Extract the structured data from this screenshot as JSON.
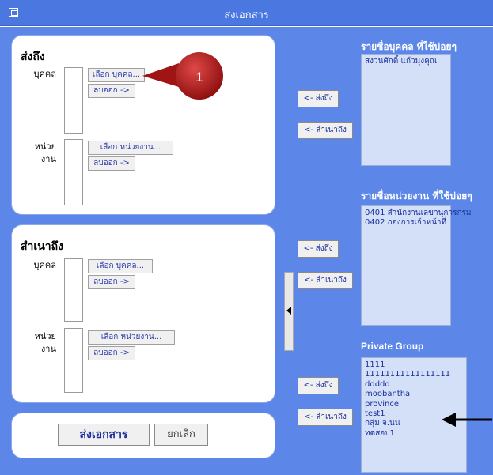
{
  "window": {
    "title": "ส่งเอกสาร"
  },
  "send_to": {
    "heading": "ส่งถึง",
    "person_label": "บุคคล",
    "unit_label_1": "หน่วย",
    "unit_label_2": "งาน",
    "select_person_button": "เลือก บุคคล...",
    "remove_person_button": "ลบออก ->",
    "select_unit_button": "เลือก หน่วยงาน...",
    "remove_unit_button": "ลบออก ->"
  },
  "copy_to": {
    "heading": "สำเนาถึง",
    "person_label": "บุคคล",
    "unit_label_1": "หน่วย",
    "unit_label_2": "งาน",
    "select_person_button": "เลือก บุคคล...",
    "remove_person_button": "ลบออก ->",
    "select_unit_button": "เลือก หน่วยงาน...",
    "remove_unit_button": "ลบออก ->"
  },
  "actions": {
    "send_button": "ส่งเอกสาร",
    "cancel_button": "ยกเลิก"
  },
  "middle": {
    "send_to_button": "<- ส่งถึง",
    "copy_to_button": "<- สำเนาถึง",
    "splitter_icon": "triangle-left-icon"
  },
  "frequent_people": {
    "header": "รายชื่อบุคคล ที่ใช้บ่อยๆ",
    "items": [
      "สงวนศักดิ์ แก้วมุงคุณ"
    ]
  },
  "frequent_units": {
    "header": "รายชื่อหน่วยงาน ที่ใช้บ่อยๆ",
    "items": [
      "0401 สำนักงานเลขานุการกรม",
      "0402 กองการเจ้าหน้าที่"
    ]
  },
  "private_group": {
    "header": "Private Group",
    "items": [
      "1111",
      "11111111111111111",
      "ddddd",
      "moobanthai",
      "province",
      "test1",
      "กลุ่ม จ.นน",
      "ทดสอบ1"
    ]
  },
  "annotation": {
    "callout_number": "1",
    "callout_color": "#b01818",
    "arrow_color": "#000000"
  },
  "colors": {
    "titlebar": "#4a78e0",
    "background": "#5c87e8",
    "list_bg": "#d4e0f8",
    "link_text": "#1a2f9c"
  }
}
